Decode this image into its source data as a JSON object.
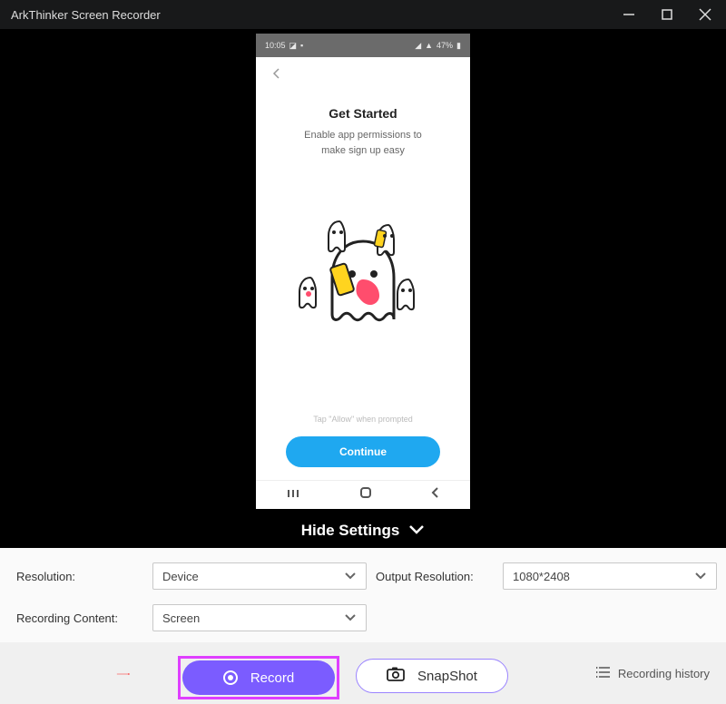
{
  "titlebar": {
    "title": "ArkThinker Screen Recorder"
  },
  "phone": {
    "status_time": "10:05",
    "status_battery": "47%",
    "heading": "Get Started",
    "subtitle_line1": "Enable app permissions to",
    "subtitle_line2": "make sign up easy",
    "tap_hint": "Tap \"Allow\" when prompted",
    "continue_label": "Continue"
  },
  "toggle": {
    "label": "Hide Settings"
  },
  "settings": {
    "resolution_label": "Resolution:",
    "resolution_value": "Device",
    "output_label": "Output Resolution:",
    "output_value": "1080*2408",
    "content_label": "Recording Content:",
    "content_value": "Screen"
  },
  "actions": {
    "record_label": "Record",
    "snapshot_label": "SnapShot",
    "history_label": "Recording history"
  }
}
